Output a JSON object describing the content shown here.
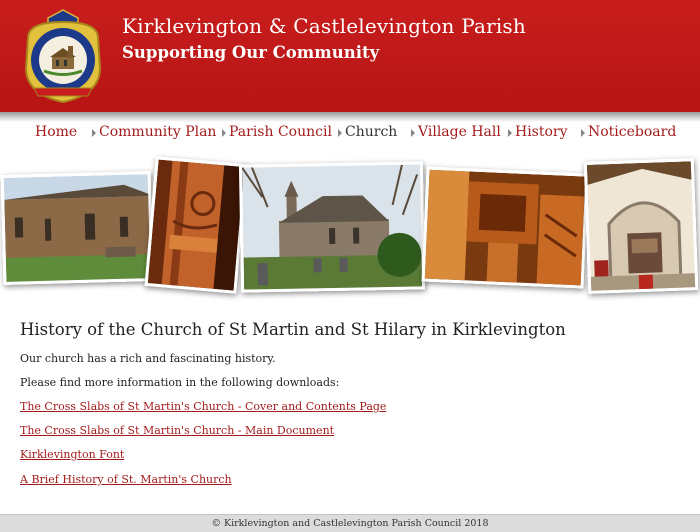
{
  "header": {
    "title": "Kirklevington & Castlelevington Parish",
    "subtitle": "Supporting Our Community",
    "logo_icon": "parish-crest-icon",
    "colors": {
      "header_red": "#c81d1d",
      "link_red": "#a31c1c"
    }
  },
  "nav": {
    "items": [
      {
        "label": "Home"
      },
      {
        "label": "Community Plan"
      },
      {
        "label": "Parish Council"
      },
      {
        "label": "Church",
        "active": true
      },
      {
        "label": "Village Hall"
      },
      {
        "label": "History"
      },
      {
        "label": "Noticeboard"
      }
    ]
  },
  "photos": [
    {
      "subject": "church-exterior-side"
    },
    {
      "subject": "carved-stone-pillar"
    },
    {
      "subject": "church-with-graveyard"
    },
    {
      "subject": "carved-capital"
    },
    {
      "subject": "church-interior-chancel"
    }
  ],
  "main": {
    "heading": "History of the Church of St Martin and St Hilary in Kirklevington",
    "intro": "Our church has a rich and fascinating history.",
    "downloads_intro": "Please find more information in the following downloads:",
    "downloads": [
      {
        "label": "The Cross Slabs of St Martin's Church - Cover and Contents Page"
      },
      {
        "label": "The Cross Slabs of St Martin's Church - Main Document"
      },
      {
        "label": "Kirklevington Font"
      },
      {
        "label": "A Brief History of St. Martin's Church"
      }
    ]
  },
  "footer": {
    "text": "© Kirklevington and Castlelevington Parish Council 2018"
  }
}
